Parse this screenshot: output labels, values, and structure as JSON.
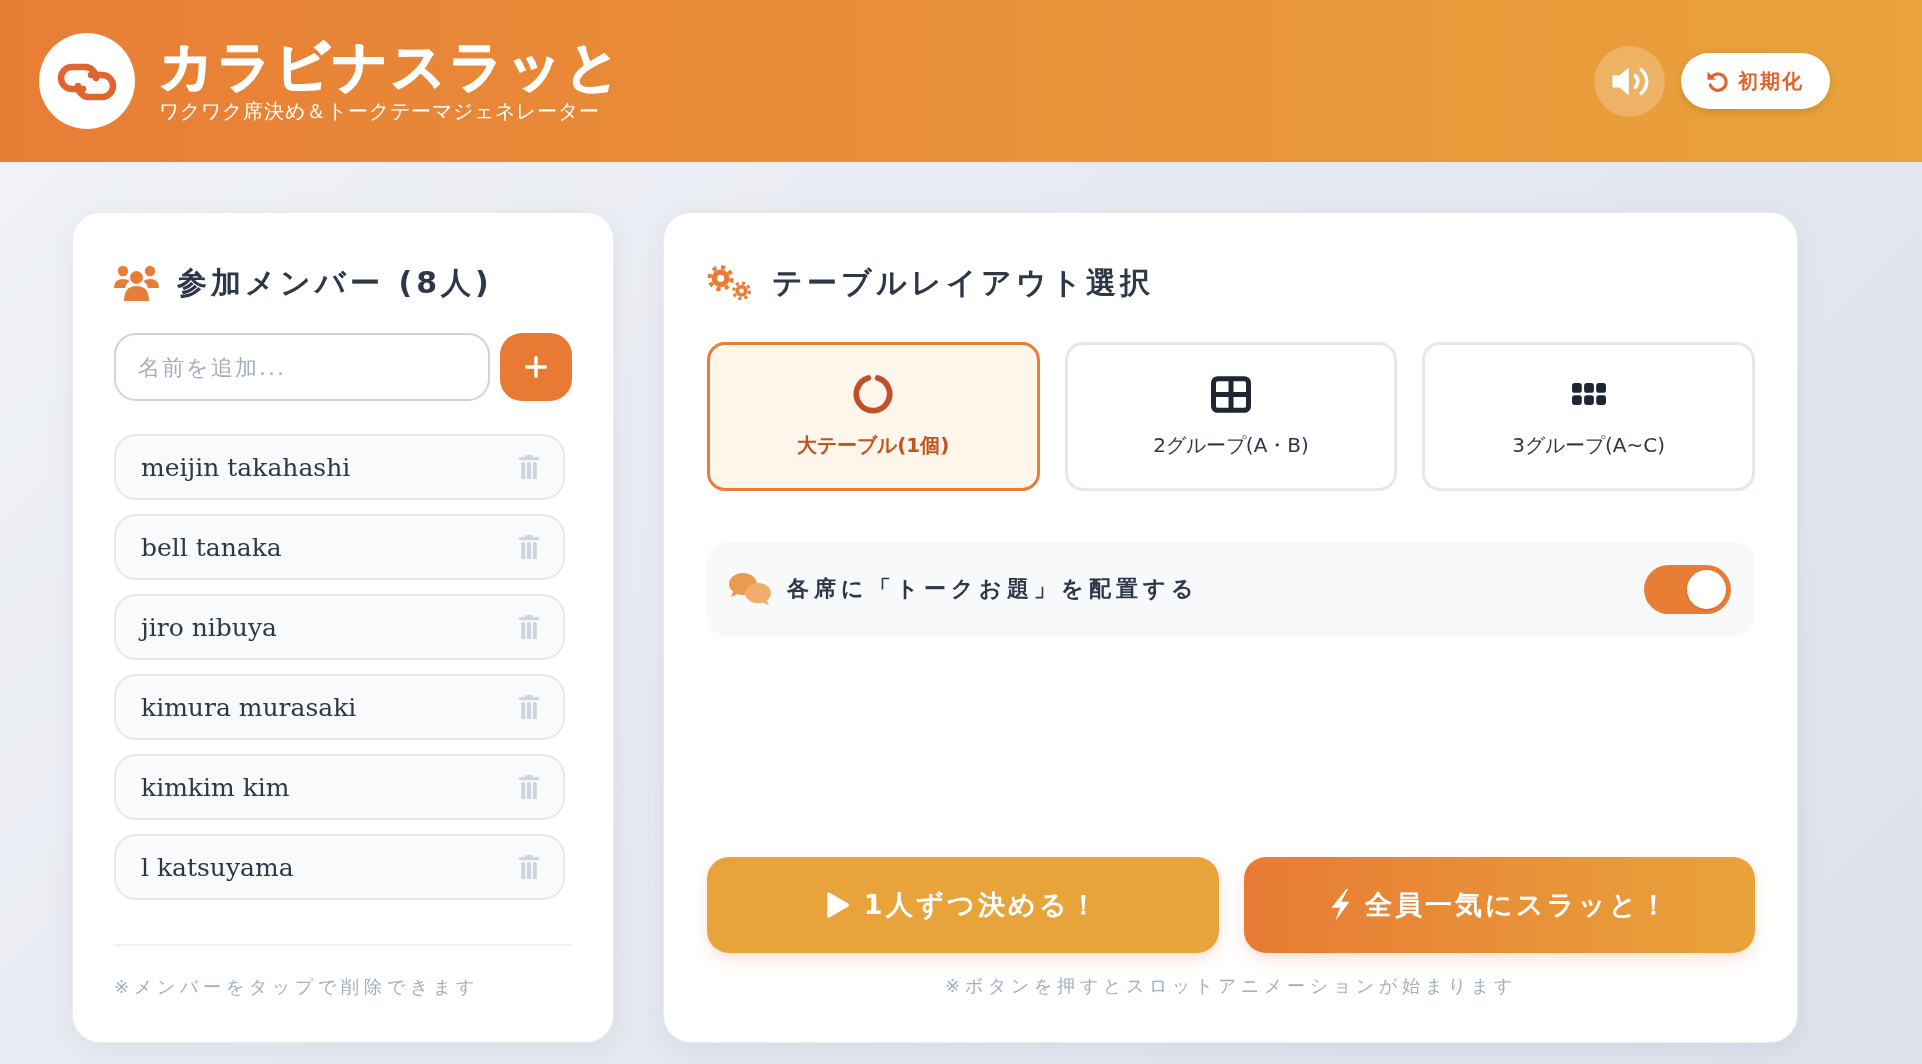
{
  "header": {
    "title": "カラビナスラッと",
    "subtitle": "ワクワク席決め＆トークテーマジェネレーター",
    "reset_button": "初期化"
  },
  "members_panel": {
    "heading": "参加メンバー (8人)",
    "name_input": {
      "placeholder": "名前を追加..."
    },
    "members": [
      {
        "name": "meijin takahashi"
      },
      {
        "name": "bell tanaka"
      },
      {
        "name": "jiro nibuya"
      },
      {
        "name": "kimura murasaki"
      },
      {
        "name": "kimkim kim"
      },
      {
        "name": "l katsuyama"
      }
    ],
    "note": "※メンバーをタップで削除できます"
  },
  "layout_panel": {
    "heading": "テーブルレイアウト選択",
    "options": [
      {
        "kind": "ring",
        "label": "大テーブル(1個)",
        "selected": true
      },
      {
        "kind": "grid",
        "label": "2グループ(A・B)",
        "selected": false
      },
      {
        "kind": "dots",
        "label": "3グループ(A~C)",
        "selected": false
      }
    ],
    "topic_toggle": {
      "label": "各席に「トークお題」を配置する",
      "on": true
    },
    "actions": [
      {
        "kind": "single",
        "label": "1人ずつ決める！"
      },
      {
        "kind": "all",
        "label": "全員一気にスラッと！"
      }
    ],
    "note": "※ボタンを押すとスロットアニメーションが始まります"
  }
}
